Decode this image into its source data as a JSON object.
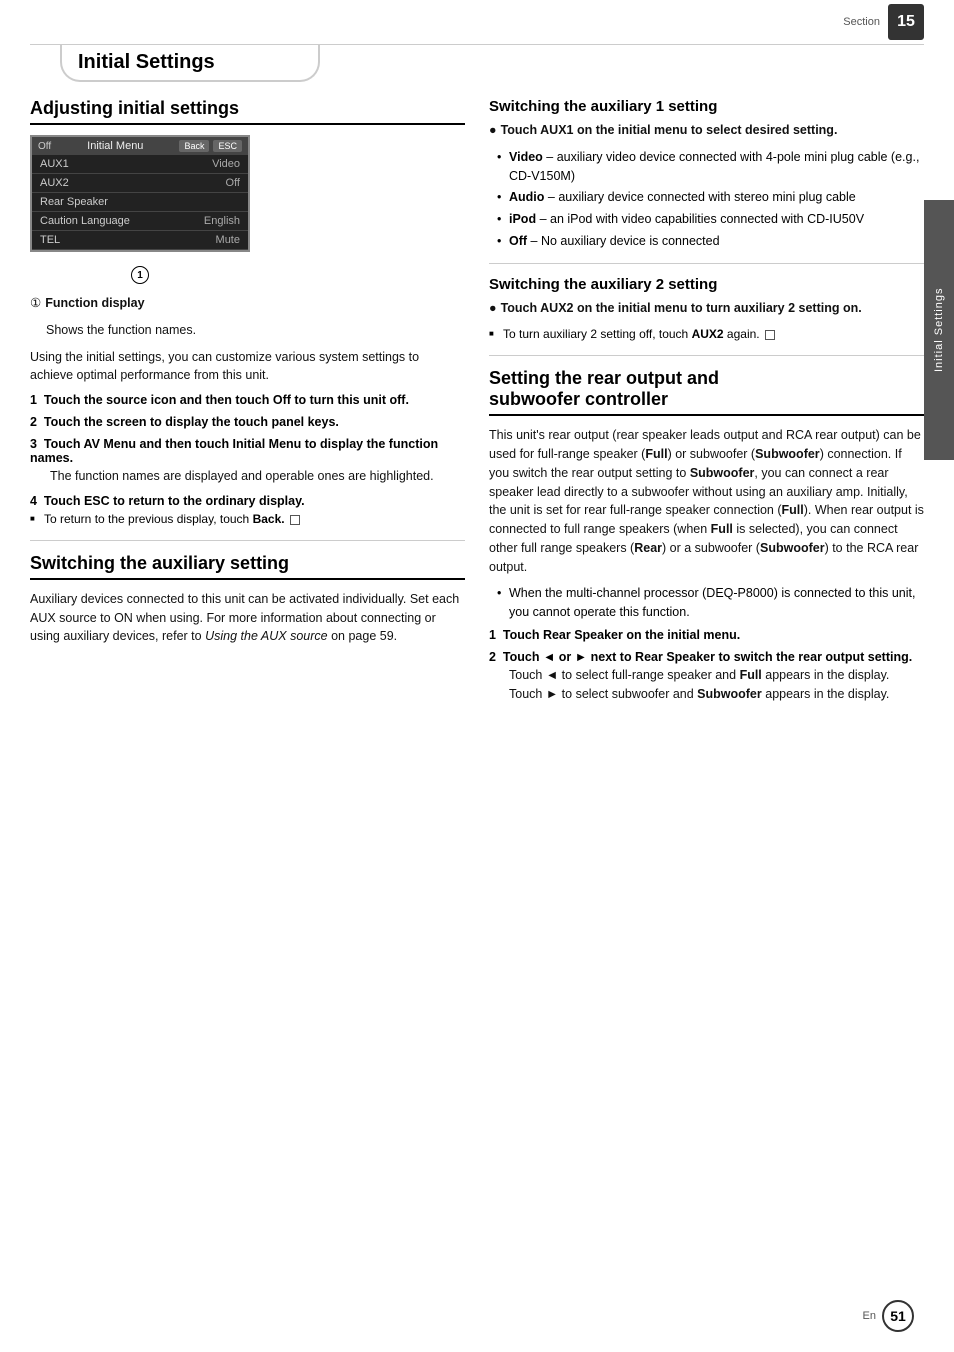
{
  "header": {
    "section_label": "Section",
    "section_number": "15",
    "page_title": "Initial Settings"
  },
  "side_label": "Initial Settings",
  "left_column": {
    "adjusting_heading": "Adjusting initial settings",
    "menu_screenshot": {
      "top_bar": {
        "off_label": "Off",
        "title": "Initial Menu",
        "back_btn": "Back",
        "esc_btn": "ESC"
      },
      "rows": [
        {
          "name": "AUX1",
          "value": "Video"
        },
        {
          "name": "AUX2",
          "value": "Off"
        },
        {
          "name": "Rear Speaker",
          "value": ""
        },
        {
          "name": "Caution Language",
          "value": "English"
        },
        {
          "name": "TEL",
          "value": "Mute"
        }
      ]
    },
    "annotation": "1",
    "function_display_label": "Function display",
    "function_display_desc": "Shows the function names.",
    "intro_text": "Using the initial settings, you can customize various system settings to achieve optimal performance from this unit.",
    "steps": [
      {
        "number": "1",
        "heading": "Touch the source icon and then touch Off to turn this unit off."
      },
      {
        "number": "2",
        "heading": "Touch the screen to display the touch panel keys."
      },
      {
        "number": "3",
        "heading": "Touch AV Menu and then touch Initial Menu to display the function names.",
        "body": "The function names are displayed and operable ones are highlighted."
      },
      {
        "number": "4",
        "heading": "Touch ESC to return to the ordinary display.",
        "note": "To return to the previous display, touch",
        "note_bold": "Back."
      }
    ],
    "switching_aux_heading": "Switching the auxiliary setting",
    "switching_aux_text": "Auxiliary devices connected to this unit can be activated individually. Set each AUX source to ON when using. For more information about connecting or using auxiliary devices, refer to",
    "switching_aux_italic": "Using the AUX source",
    "switching_aux_text2": "on page 59."
  },
  "right_column": {
    "aux1_heading": "Switching the auxiliary 1 setting",
    "aux1_bullet_intro": "Touch AUX1 on the initial menu to select desired setting.",
    "aux1_bullets": [
      {
        "bold": "Video",
        "text": " – auxiliary video device connected with 4-pole mini plug cable (e.g., CD-V150M)"
      },
      {
        "bold": "Audio",
        "text": " – auxiliary device connected with stereo mini plug cable"
      },
      {
        "bold": "iPod",
        "text": " – an iPod with video capabilities connected with CD-IU50V"
      },
      {
        "bold": "Off",
        "text": " – No auxiliary device is connected"
      }
    ],
    "aux2_heading": "Switching the auxiliary 2 setting",
    "aux2_bullet_intro": "Touch AUX2 on the initial menu to turn auxiliary 2 setting on.",
    "aux2_note": "To turn auxiliary 2 setting off, touch",
    "aux2_note_bold": "AUX2",
    "aux2_note2": "again.",
    "rear_heading": "Setting the rear output and subwoofer controller",
    "rear_text1": "This unit's rear output (rear speaker leads output and RCA rear output) can be used for full-range speaker (",
    "rear_text1_bold": "Full",
    "rear_text1b": ") or subwoofer (",
    "rear_text1c_bold": "Subwoofer",
    "rear_text1d": ") connection. If you switch the rear output setting to ",
    "rear_text1e_bold": "Subwoofer",
    "rear_text1f": ", you can connect a rear speaker lead directly to a subwoofer without using an auxiliary amp. Initially, the unit is set for rear full-range speaker connection (",
    "rear_text1g_bold": "Full",
    "rear_text1h": "). When rear output is connected to full range speakers (when ",
    "rear_text1i_bold": "Full",
    "rear_text1j": " is selected), you can connect other full range speakers (",
    "rear_text1k_bold": "Rear",
    "rear_text1l": ") or a subwoofer (",
    "rear_text1m_bold": "Subwoofer",
    "rear_text1n": ") to the RCA rear output.",
    "rear_bullet1": "When the multi-channel processor (DEQ-P8000) is connected to this unit, you cannot operate this function.",
    "rear_step1_number": "1",
    "rear_step1_heading": "Touch Rear Speaker on the initial menu.",
    "rear_step2_number": "2",
    "rear_step2_heading": "Touch ◄ or ► next to Rear Speaker to switch the rear output setting.",
    "rear_step2_body1": "Touch ◄ to select full-range speaker and ",
    "rear_step2_body1_bold": "Full",
    "rear_step2_body2": " appears in the display. Touch ► to select subwoofer and ",
    "rear_step2_body2_bold": "Subwoofer",
    "rear_step2_body3": " appears in the display."
  },
  "footer": {
    "en_label": "En",
    "page_number": "51"
  }
}
